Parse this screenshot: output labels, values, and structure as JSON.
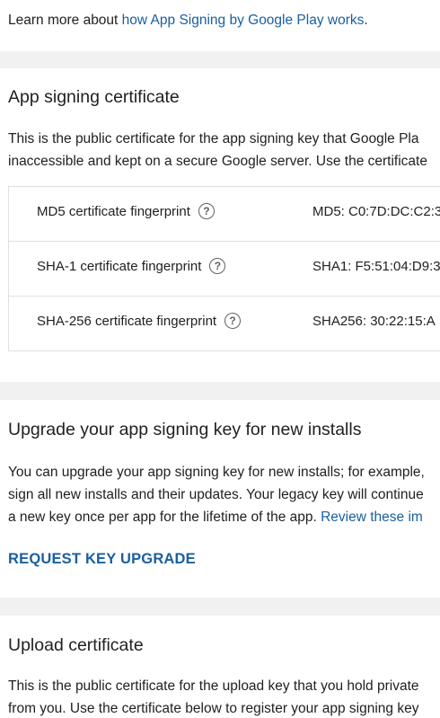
{
  "learn_more": {
    "prefix": "Learn more about ",
    "link": "how App Signing by Google Play works",
    "suffix": "."
  },
  "app_signing": {
    "title": "App signing certificate",
    "desc_line1": "This is the public certificate for the app signing key that Google Pla",
    "desc_line2": "inaccessible and kept on a secure Google server. Use the certificate",
    "rows": [
      {
        "label": "MD5 certificate fingerprint",
        "value": "MD5: C0:7D:DC:C2:3",
        "icon": "help-circle-icon"
      },
      {
        "label": "SHA-1 certificate fingerprint",
        "value": "SHA1: F5:51:04:D9:3",
        "icon": "help-circle-icon"
      },
      {
        "label": "SHA-256 certificate fingerprint",
        "value": "SHA256: 30:22:15:A",
        "icon": "help-circle-icon"
      }
    ]
  },
  "upgrade": {
    "title": "Upgrade your app signing key for new installs",
    "line1": "You can upgrade your app signing key for new installs; for example,",
    "line2": "sign all new installs and their updates. Your legacy key will continue",
    "line3_prefix": "a new key once per app for the lifetime of the app. ",
    "line3_link": "Review these im",
    "button": "REQUEST KEY UPGRADE"
  },
  "upload": {
    "title": "Upload certificate",
    "line1": "This is the public certificate for the upload key that you hold private",
    "line2": "from you. Use the certificate below to register your app signing key"
  },
  "colors": {
    "link": "#1a5fa0",
    "background": "#f1f1f1",
    "card": "#ffffff",
    "border": "#e0e0e0"
  }
}
